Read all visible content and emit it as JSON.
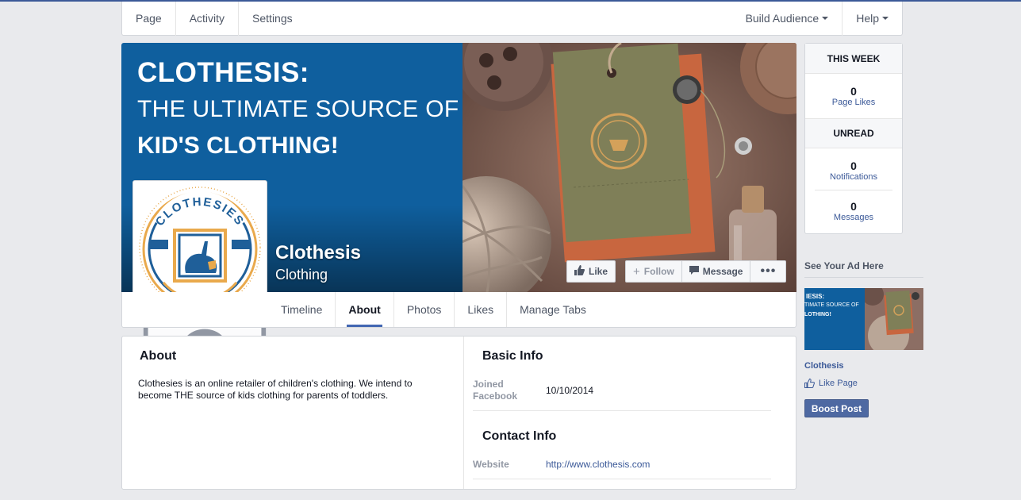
{
  "admin_nav": {
    "page": "Page",
    "activity": "Activity",
    "settings": "Settings",
    "build_audience": "Build Audience",
    "help": "Help"
  },
  "cover": {
    "headline_1": "CLOTHESIS:",
    "headline_2": "THE ULTIMATE SOURCE OF",
    "headline_3": "KID'S CLOTHING!",
    "page_name": "Clothesis",
    "page_category": "Clothing",
    "logo_text": "CLOTHESIES",
    "actions": {
      "like": "Like",
      "follow": "Follow",
      "message": "Message",
      "more": "•••"
    }
  },
  "tabs": [
    {
      "label": "Timeline"
    },
    {
      "label": "About"
    },
    {
      "label": "Photos"
    },
    {
      "label": "Likes"
    },
    {
      "label": "Manage Tabs"
    }
  ],
  "about": {
    "title": "About",
    "description": "Clothesies is an online retailer of children's clothing. We intend to become THE source of kids clothing for parents of toddlers."
  },
  "basic_info": {
    "title": "Basic Info",
    "joined_label": "Joined Facebook",
    "joined_value": "10/10/2014"
  },
  "contact_info": {
    "title": "Contact Info",
    "website_label": "Website",
    "website_value": "http://www.clothesis.com"
  },
  "sidebar": {
    "this_week": "THIS WEEK",
    "page_likes_count": "0",
    "page_likes_label": "Page Likes",
    "unread": "UNREAD",
    "notifications_count": "0",
    "notifications_label": "Notifications",
    "messages_count": "0",
    "messages_label": "Messages"
  },
  "ad": {
    "title": "See Your Ad Here",
    "img_line_1": "IESIS:",
    "img_line_2": "TIMATE SOURCE OF",
    "img_line_3": "LOTHING!",
    "page_name": "Clothesis",
    "like_page": "Like Page",
    "boost": "Boost Post"
  },
  "colors": {
    "facebook_blue": "#3b5998",
    "cover_blue": "#0f5f9e",
    "background": "#e9eaed",
    "boost_button": "#4e69a2"
  }
}
